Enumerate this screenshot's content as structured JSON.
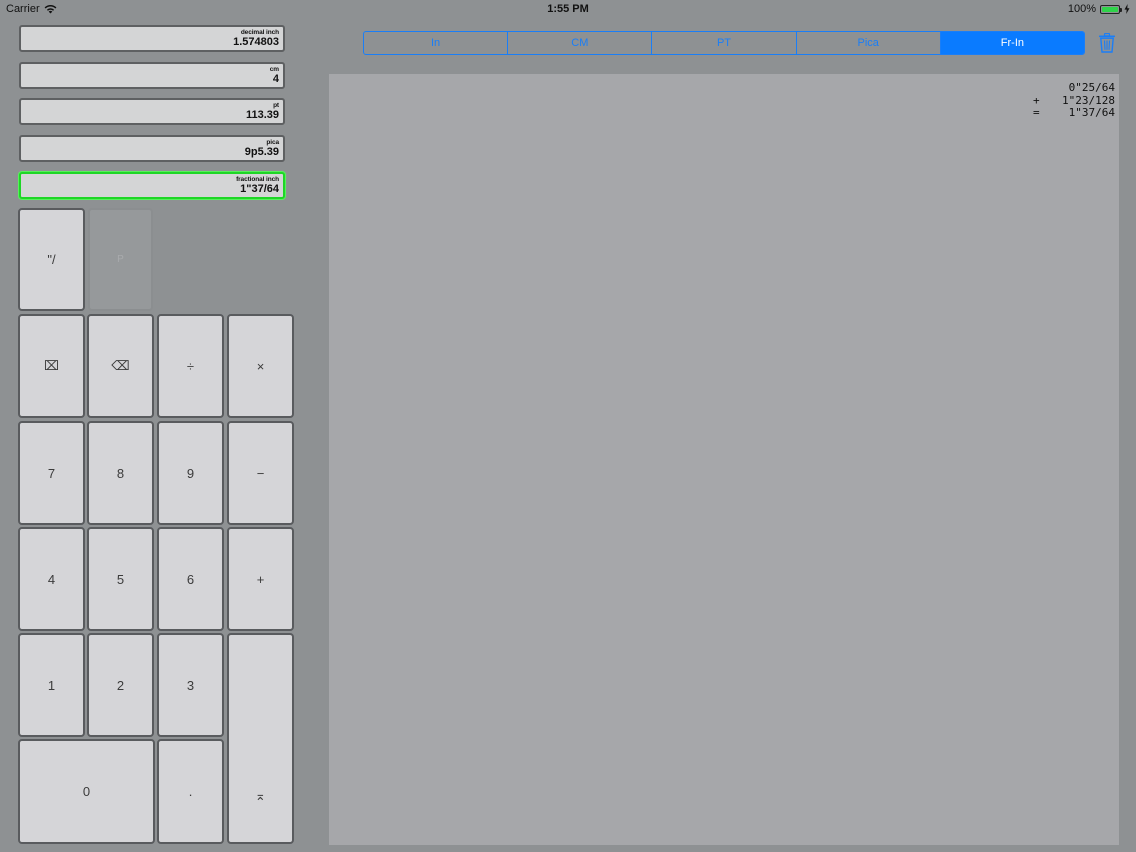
{
  "status_bar": {
    "carrier": "Carrier",
    "time": "1:55 PM",
    "battery": "100%"
  },
  "displays": [
    {
      "label": "decimal inch",
      "value": "1.574803",
      "active": false
    },
    {
      "label": "cm",
      "value": "4",
      "active": false
    },
    {
      "label": "pt",
      "value": "113.39",
      "active": false
    },
    {
      "label": "pica",
      "value": "9p5.39",
      "active": false
    },
    {
      "label": "fractional inch",
      "value": "1\"37/64",
      "active": true
    }
  ],
  "keypad": {
    "frac": "\"/",
    "p_key": "P",
    "clear": "⌧",
    "backspace": "⌫",
    "divide": "÷",
    "multiply": "×",
    "k7": "7",
    "k8": "8",
    "k9": "9",
    "minus": "−",
    "k4": "4",
    "k5": "5",
    "k6": "6",
    "plus": "+",
    "k1": "1",
    "k2": "2",
    "k3": "3",
    "enter": "⌅",
    "k0": "0",
    "dot": "."
  },
  "units_tabs": [
    {
      "label": "In",
      "selected": false
    },
    {
      "label": "CM",
      "selected": false
    },
    {
      "label": "PT",
      "selected": false
    },
    {
      "label": "Pica",
      "selected": false
    },
    {
      "label": "Fr-In",
      "selected": true
    }
  ],
  "tape": [
    {
      "op": "",
      "value": "0\"25/64"
    },
    {
      "op": "+",
      "value": "1\"23/128"
    },
    {
      "op": "=",
      "value": "1\"37/64"
    }
  ],
  "colors": {
    "accent": "#0a7bff",
    "active_border": "#1ed626",
    "battery": "#2fd34a"
  },
  "icons": {
    "wifi": "wifi-icon",
    "battery": "battery-icon",
    "charging": "bolt-icon",
    "trash": "trash-icon"
  }
}
